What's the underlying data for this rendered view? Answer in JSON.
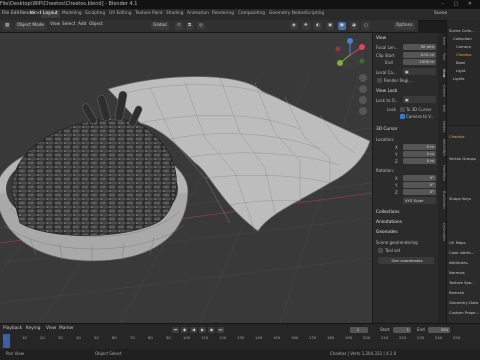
{
  "titlebar": {
    "title": "File\\Desktop\\WIP\\Cheetos\\Cheetos.blend] - Blender 4.1",
    "controls": "– ▢ ✕"
  },
  "menu": {
    "items": [
      "File",
      "Edit",
      "Render",
      "Window",
      "Help"
    ]
  },
  "workspaces": {
    "tabs": [
      "Layout",
      "Modeling",
      "Sculpting",
      "UV Editing",
      "Texture Paint",
      "Shading",
      "Animation",
      "Rendering",
      "Compositing",
      "Geometry Nodes",
      "Scripting"
    ],
    "scene_label": "Scene",
    "viewlayer_label": "ViewLayer"
  },
  "viewport_header": {
    "mode": "Object Mode",
    "view": "View",
    "select": "Select",
    "add": "Add",
    "object": "Object",
    "orientation": "Global",
    "options": "Options"
  },
  "npanel": {
    "view_header": "View",
    "focal_label": "Focal Len...",
    "focal_value": "50 mm",
    "clip_start_label": "Clip Start",
    "clip_start_value": "0.01 m",
    "clip_end_label": "End",
    "clip_end_value": "1000 m",
    "local_camera_label": "Local Ca...",
    "render_region_label": "Render Regi...",
    "view_lock_header": "View Lock",
    "lock_to_object_label": "Lock to O...",
    "lock_label": "Lock",
    "to_3d_cursor": "To 3D Cursor",
    "camera_to_view": "Camera to V...",
    "cursor_header": "3D Cursor",
    "location_label": "Location:",
    "x_label": "X",
    "x_value": "0 m",
    "y_label": "Y",
    "y_value": "0 m",
    "z_label": "Z",
    "z_value": "0 m",
    "rotation_label": "Rotation:",
    "rx_value": "0°",
    "ry_value": "0°",
    "rz_value": "0°",
    "rotation_mode": "XYZ Euler",
    "collections_header": "Collections",
    "annotations_header": "Annotations",
    "geonodes_header": "Geonodes",
    "scene_geo_label": "Scene geo/rendering",
    "tool_set_label": "Tool set",
    "gen_coords_label": "Gen coordinates"
  },
  "ntabs": [
    "Item",
    "Tool",
    "View",
    "Create",
    "Edit",
    "Nodes",
    "MACHIN3",
    "HardOps",
    "BoxCutter",
    "Geonodes"
  ],
  "outliner": {
    "rows": [
      "Scene Colle...",
      "Collection",
      "Camera",
      "Cheetos",
      "Bowl",
      "Light",
      "Lights"
    ]
  },
  "properties": {
    "rows": [
      "Cheetos",
      "Vertex Groups",
      "Shape Keys",
      "UV Maps",
      "Color Attrib...",
      "Attributes",
      "Normals",
      "Texture Spa...",
      "Remesh",
      "Geometry Data",
      "Custom Prope..."
    ]
  },
  "timeline": {
    "playback": "Playback",
    "keying": "Keying",
    "view": "View",
    "marker": "Marker",
    "ticks": [
      "0",
      "10",
      "20",
      "30",
      "40",
      "50",
      "60",
      "70",
      "80",
      "90",
      "100",
      "110",
      "120",
      "130",
      "140",
      "150",
      "160",
      "170",
      "180",
      "190",
      "200",
      "210",
      "220",
      "230",
      "240",
      "250"
    ],
    "current_frame": "1",
    "start_label": "Start",
    "start_value": "1",
    "end_label": "End",
    "end_value": "250"
  },
  "statusbar": {
    "left": "Pan View",
    "mid": "Object Select",
    "right": "Cheetos | Verts 1,204,322 | 4.1.0"
  }
}
